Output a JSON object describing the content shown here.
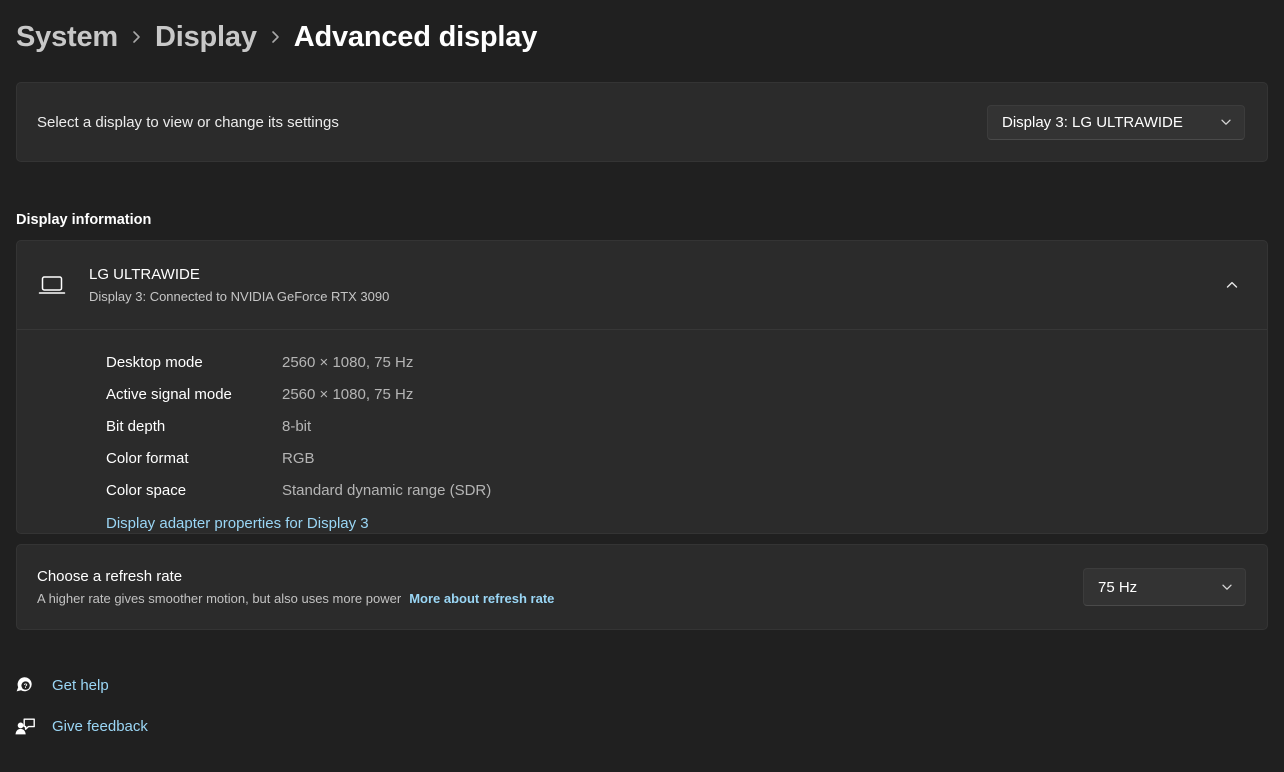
{
  "breadcrumb": {
    "items": [
      {
        "label": "System",
        "current": false
      },
      {
        "label": "Display",
        "current": false
      },
      {
        "label": "Advanced display",
        "current": true
      }
    ],
    "separator_icon": "chevron-right-icon"
  },
  "display_select": {
    "label": "Select a display to view or change its settings",
    "combobox": {
      "value": "Display 3: LG ULTRAWIDE",
      "chevron_icon": "chevron-down-icon"
    }
  },
  "section": {
    "heading": "Display information"
  },
  "display_info": {
    "icon": "laptop-monitor-icon",
    "title": "LG ULTRAWIDE",
    "subtitle": "Display 3: Connected to NVIDIA GeForce RTX 3090",
    "toggle_icon": "chevron-up-icon",
    "expanded": true,
    "rows": [
      {
        "label": "Desktop mode",
        "value": "2560 × 1080, 75 Hz"
      },
      {
        "label": "Active signal mode",
        "value": "2560 × 1080, 75 Hz"
      },
      {
        "label": "Bit depth",
        "value": "8-bit"
      },
      {
        "label": "Color format",
        "value": "RGB"
      },
      {
        "label": "Color space",
        "value": "Standard dynamic range (SDR)"
      }
    ],
    "adapter_link": "Display adapter properties for Display 3"
  },
  "refresh_rate": {
    "title": "Choose a refresh rate",
    "description": "A higher rate gives smoother motion, but also uses more power",
    "more_link": "More about refresh rate",
    "combobox": {
      "value": "75 Hz",
      "chevron_icon": "chevron-down-icon"
    }
  },
  "footer": {
    "links": [
      {
        "label": "Get help",
        "icon": "get-help-icon"
      },
      {
        "label": "Give feedback",
        "icon": "give-feedback-icon"
      }
    ]
  },
  "colors": {
    "page_background": "#202020",
    "card_background": "#2b2b2b",
    "card_border": "#343434",
    "control_background": "#333333",
    "accent_link": "#9ad6f5",
    "text_primary": "#ffffff",
    "text_secondary": "#b5b5b5"
  }
}
